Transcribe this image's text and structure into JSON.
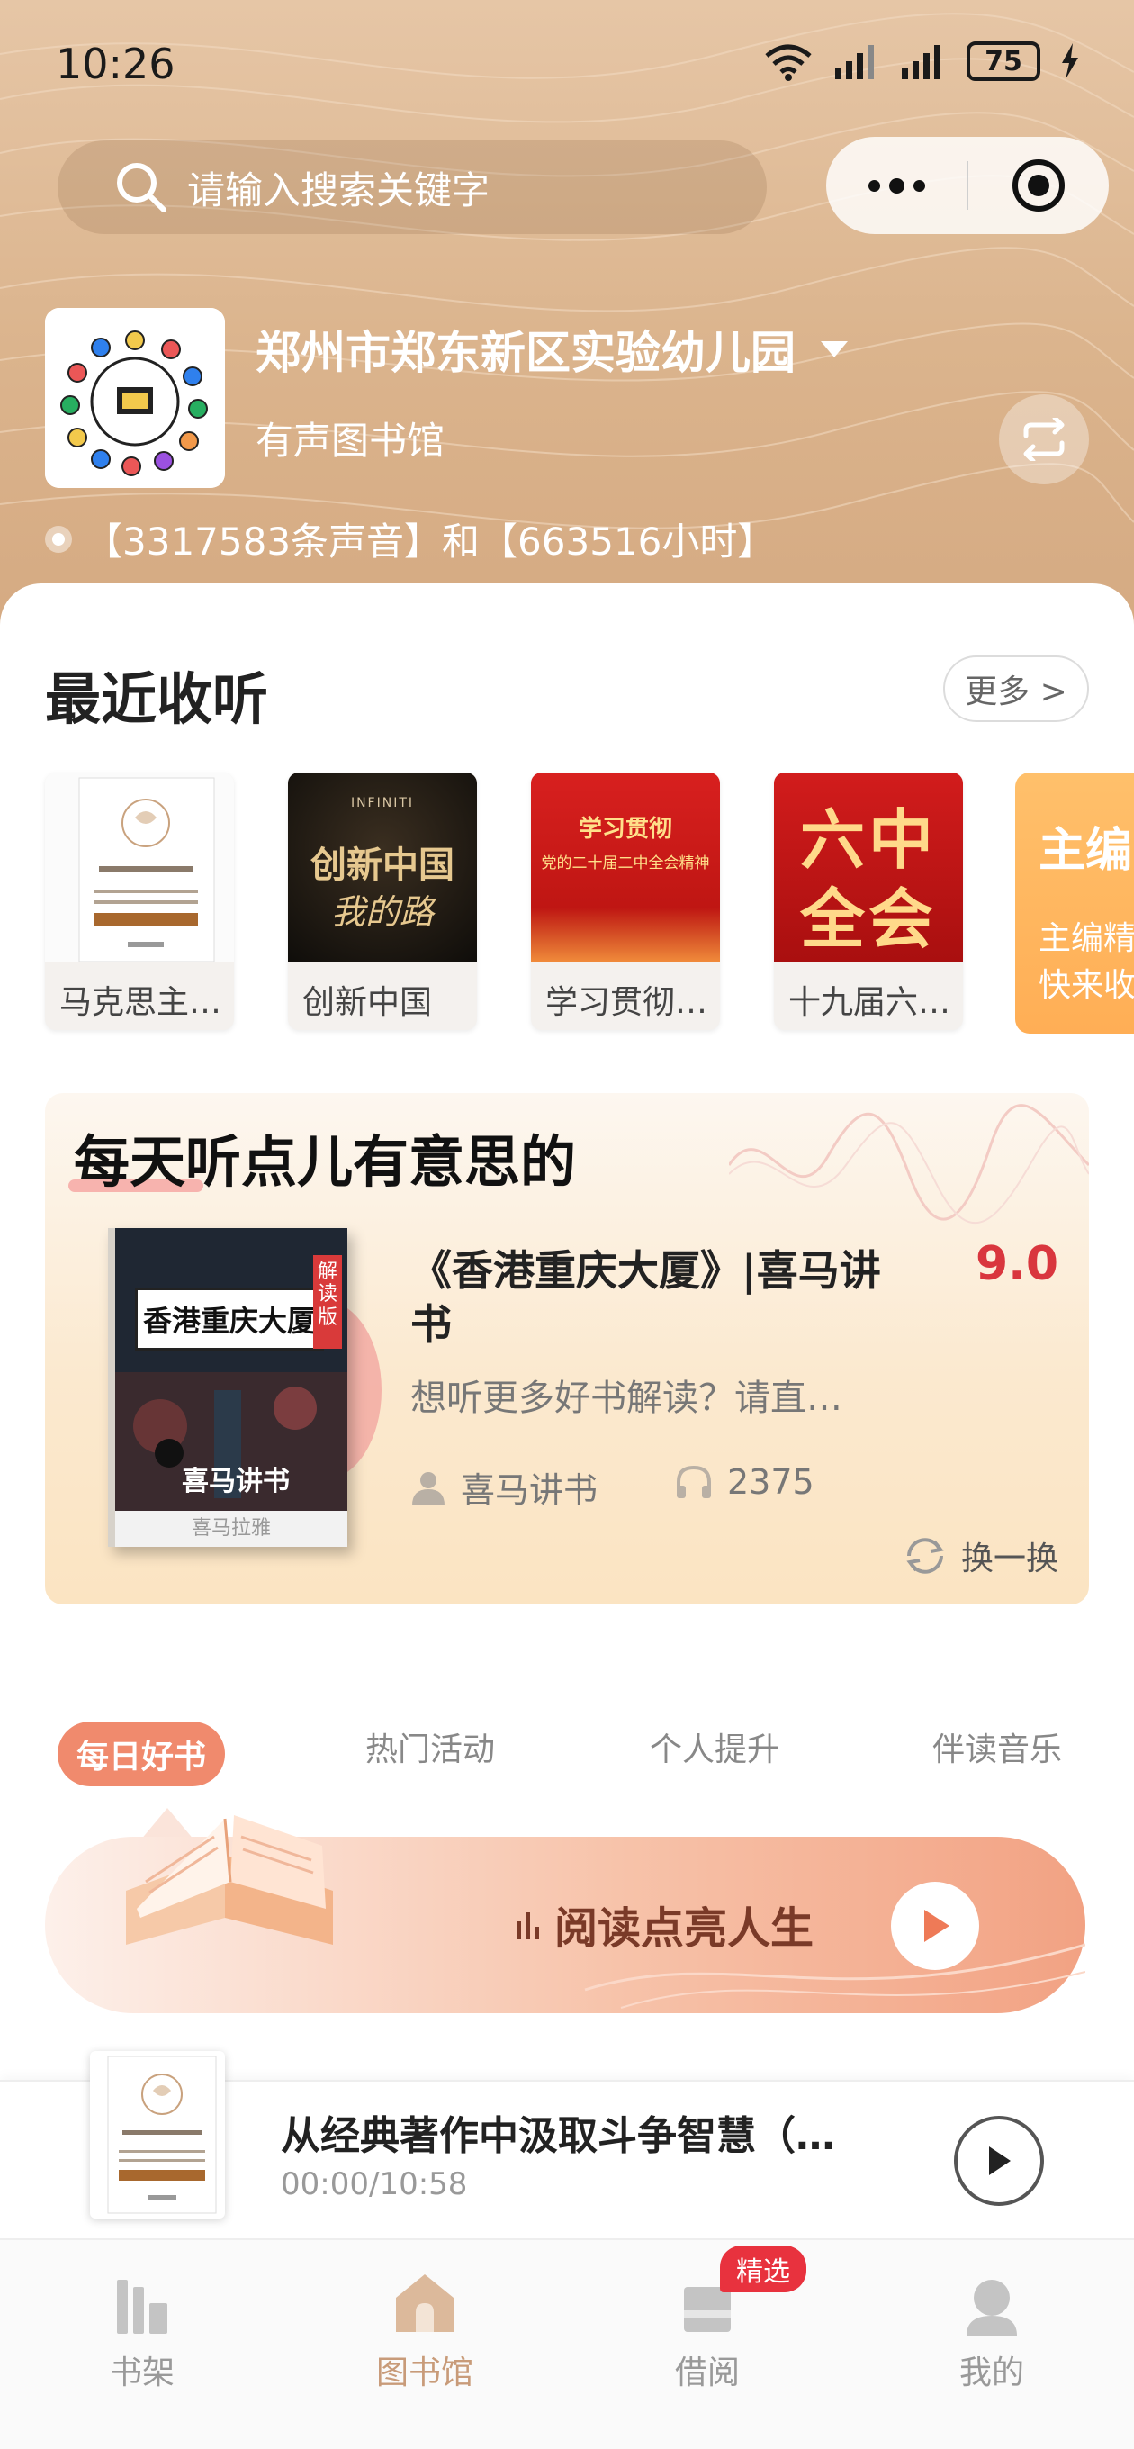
{
  "status": {
    "time": "10:26",
    "battery": "75"
  },
  "search": {
    "placeholder": "请输入搜索关键字"
  },
  "library": {
    "name": "郑州市郑东新区实验幼儿园",
    "subtitle": "有声图书馆",
    "stats": "【3317583条声音】和【663516小时】"
  },
  "recent": {
    "title": "最近收听",
    "more": "更多 >",
    "items": [
      {
        "label": "马克思主…",
        "cover_text": "马克思主义诞生四…"
      },
      {
        "label": "创新中国",
        "cover_text": "创新中国",
        "cover_sub": "我的路",
        "brand": "INFINITI"
      },
      {
        "label": "学习贯彻…",
        "cover_text": "学习贯彻",
        "cover_sub": "党的二十届二中全会精神"
      },
      {
        "label": "十九届六…",
        "cover_text": "六中",
        "cover_sub": "全会"
      }
    ],
    "partial": {
      "title": "主编",
      "line1": "主编精",
      "line2": "快来收"
    }
  },
  "daily": {
    "title": "每天听点儿有意思的",
    "book_title": "《香港重庆大厦》|喜马讲书",
    "score": "9.0",
    "description": "想听更多好书解读？请直…",
    "author": "喜马讲书",
    "plays": "2375",
    "refresh": "换一换",
    "cover": {
      "title": "香港重庆大厦",
      "badge": "解读版",
      "sub": "喜马讲书",
      "bottom": "喜马拉雅"
    }
  },
  "tabs": [
    {
      "label": "每日好书",
      "active": true
    },
    {
      "label": "热门活动",
      "active": false
    },
    {
      "label": "个人提升",
      "active": false
    },
    {
      "label": "伴读音乐",
      "active": false
    }
  ],
  "banner": {
    "text": "阅读点亮人生"
  },
  "player": {
    "title": "从经典著作中汲取斗争智慧（…",
    "time": "00:00/10:58"
  },
  "nav": [
    {
      "label": "书架",
      "active": false
    },
    {
      "label": "图书馆",
      "active": true
    },
    {
      "label": "借阅",
      "active": false,
      "badge": "精选"
    },
    {
      "label": "我的",
      "active": false
    }
  ],
  "colors": {
    "accent": "#f08a6d",
    "score": "#d9363e",
    "header": "#dbb48d",
    "nav_active": "#c89b79"
  }
}
